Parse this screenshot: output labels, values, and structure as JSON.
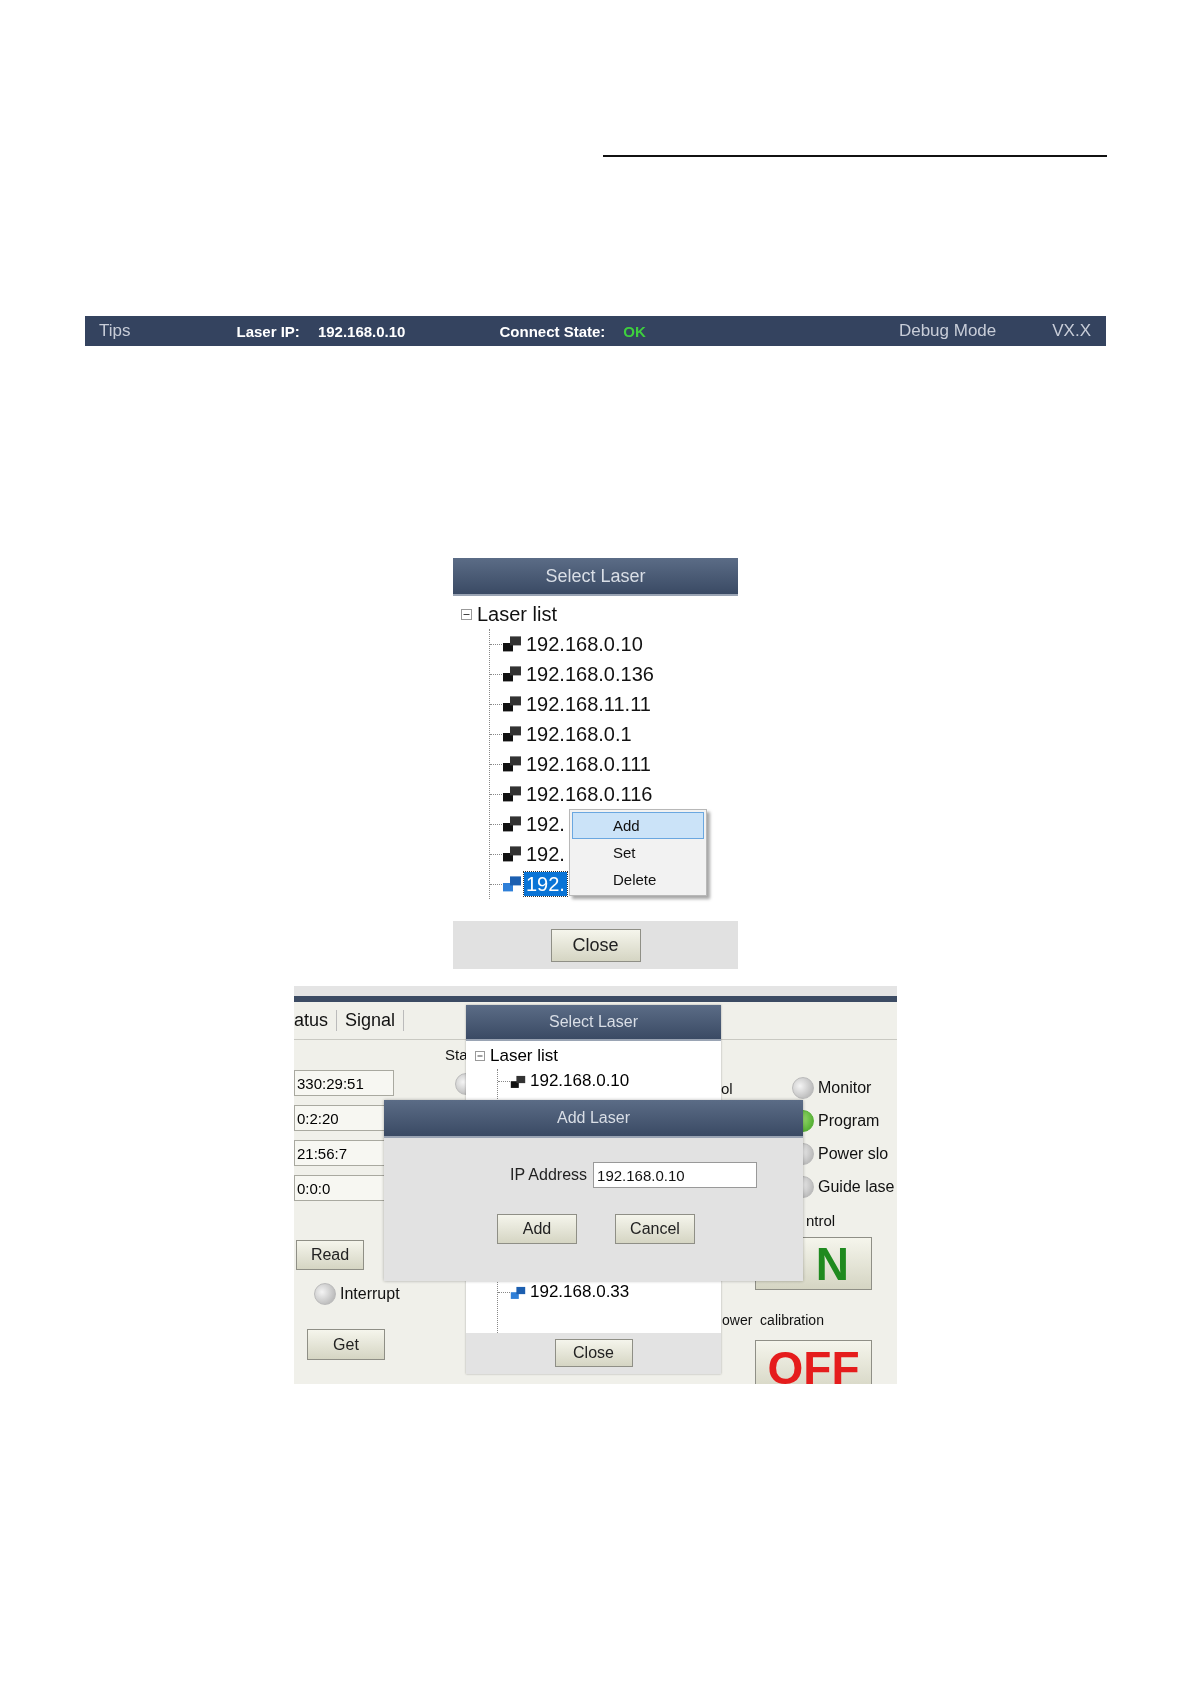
{
  "status_bar": {
    "tips": "Tips",
    "laser_ip_label": "Laser IP:",
    "laser_ip": "192.168.0.10",
    "connect_state_label": "Connect State:",
    "connect_state": "OK",
    "mode": "Debug Mode",
    "version": "VX.X"
  },
  "select_laser_dialog": {
    "title": "Select Laser",
    "tree": {
      "label": "Laser list",
      "expanded": true,
      "focused": true,
      "children": [
        {
          "label": "192.168.0.10",
          "selected": false
        },
        {
          "label": "192.168.0.136",
          "selected": false
        },
        {
          "label": "192.168.11.11",
          "selected": false
        },
        {
          "label": "192.168.0.1",
          "selected": false
        },
        {
          "label": "192.168.0.111",
          "selected": false
        },
        {
          "label": "192.168.0.116",
          "selected": false
        },
        {
          "label": "192.",
          "selected": false
        },
        {
          "label": "192.",
          "selected": false
        },
        {
          "label": "192.",
          "selected": true
        }
      ]
    },
    "context_menu": [
      {
        "label": "Add",
        "selected": true
      },
      {
        "label": "Set",
        "selected": false
      },
      {
        "label": "Delete",
        "selected": false
      }
    ],
    "close_button": "Close"
  },
  "add_laser_screenshot": {
    "tabs": [
      {
        "label": "atus"
      },
      {
        "label": "Signal"
      }
    ],
    "time_fields": [
      "330:29:51",
      "0:2:20",
      "21:56:7",
      "0:0:0"
    ],
    "read_button": "Read",
    "interrupt": {
      "label": "Interrupt",
      "on": false
    },
    "get_button": "Get",
    "status_group": {
      "label": "Sta",
      "on": false
    },
    "control_group_label": "ol",
    "mode_indicators": [
      {
        "label": "Monitor",
        "on": false
      },
      {
        "label": "Program",
        "on": true
      },
      {
        "label": "Power slo",
        "on": false
      },
      {
        "label": "Guide lase",
        "on": false
      }
    ],
    "laser_control": {
      "label": "ntrol",
      "button": "N"
    },
    "power_calibration": {
      "label": "ower  calibration",
      "button": "OFF"
    },
    "select_laser_dialog": {
      "title": "Select Laser",
      "tree": {
        "label": "Laser list",
        "expanded": true,
        "focused": false,
        "children": [
          {
            "label": "192.168.0.10",
            "selected": false
          },
          {
            "label": "192.168.0.33",
            "selected": true
          }
        ]
      },
      "close_button": "Close"
    },
    "add_laser_dialog": {
      "title": "Add Laser",
      "ip_label": "IP Address",
      "ip_value": "192.168.0.10",
      "buttons": [
        "Add",
        "Cancel"
      ]
    }
  }
}
